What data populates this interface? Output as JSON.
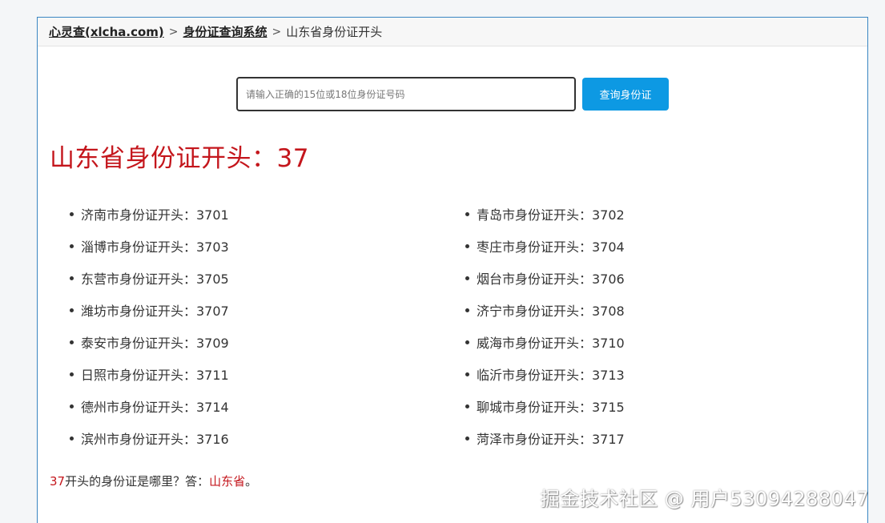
{
  "breadcrumb": {
    "home": "心灵查(xlcha.com)",
    "section": "身份证查询系统",
    "current": "山东省身份证开头",
    "separator": ">"
  },
  "search": {
    "placeholder": "请输入正确的15位或18位身份证号码",
    "button_label": "查询身份证"
  },
  "title": "山东省身份证开头：37",
  "cities": [
    {
      "label": "济南市身份证开头：3701"
    },
    {
      "label": "青岛市身份证开头：3702"
    },
    {
      "label": "淄博市身份证开头：3703"
    },
    {
      "label": "枣庄市身份证开头：3704"
    },
    {
      "label": "东营市身份证开头：3705"
    },
    {
      "label": "烟台市身份证开头：3706"
    },
    {
      "label": "潍坊市身份证开头：3707"
    },
    {
      "label": "济宁市身份证开头：3708"
    },
    {
      "label": "泰安市身份证开头：3709"
    },
    {
      "label": "威海市身份证开头：3710"
    },
    {
      "label": "日照市身份证开头：3711"
    },
    {
      "label": "临沂市身份证开头：3713"
    },
    {
      "label": "德州市身份证开头：3714"
    },
    {
      "label": "聊城市身份证开头：3715"
    },
    {
      "label": "滨州市身份证开头：3716"
    },
    {
      "label": "菏泽市身份证开头：3717"
    }
  ],
  "answer": {
    "code": "37",
    "question": "开头的身份证是哪里？答：",
    "province": "山东省",
    "end": "。"
  },
  "watermark": "掘金技术社区 @ 用户53094288047",
  "colors": {
    "accent_red": "#c4161c",
    "button_blue": "#0d99e3",
    "panel_border": "#3a86c2"
  }
}
